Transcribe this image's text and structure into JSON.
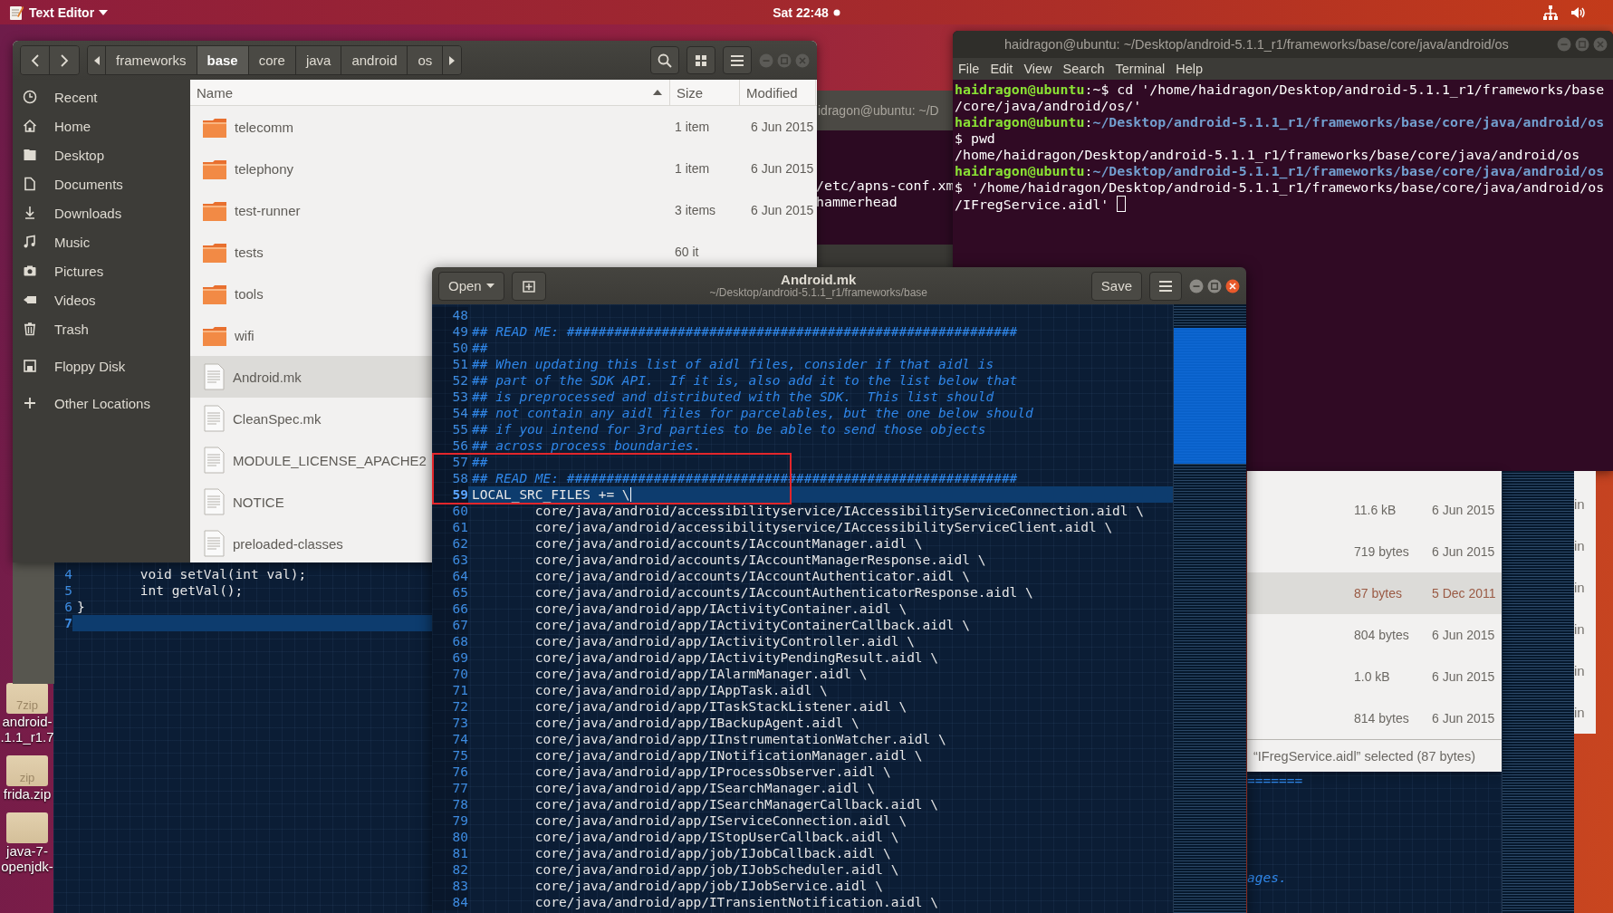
{
  "top_bar": {
    "app_menu": "Text Editor",
    "clock": "Sat 22:48"
  },
  "desktop_icons": [
    {
      "kind": "sevenzip",
      "badge": "7zip",
      "label": [
        "android-",
        ".1.1_r1.7"
      ]
    },
    {
      "kind": "zip",
      "badge": "zip",
      "label": [
        "frida.zip"
      ]
    },
    {
      "kind": "archive",
      "label": [
        "java-7-",
        "openjdk-"
      ]
    }
  ],
  "background_terminal": {
    "title": "idragon@ubuntu: ~/D",
    "lines": [
      "/etc/apns-conf.xm",
      "hammerhead"
    ]
  },
  "file_manager": {
    "path": [
      {
        "label": "frameworks",
        "selected": false
      },
      {
        "label": "base",
        "selected": true
      },
      {
        "label": "core",
        "selected": false
      },
      {
        "label": "java",
        "selected": false
      },
      {
        "label": "android",
        "selected": false
      },
      {
        "label": "os",
        "selected": false
      }
    ],
    "sidebar": [
      {
        "kind": "recent",
        "label": "Recent"
      },
      {
        "kind": "home",
        "label": "Home"
      },
      {
        "kind": "desktop",
        "label": "Desktop"
      },
      {
        "kind": "documents",
        "label": "Documents"
      },
      {
        "kind": "downloads",
        "label": "Downloads"
      },
      {
        "kind": "music",
        "label": "Music"
      },
      {
        "kind": "pictures",
        "label": "Pictures"
      },
      {
        "kind": "videos",
        "label": "Videos"
      },
      {
        "kind": "trash",
        "label": "Trash"
      },
      {
        "kind": "floppy",
        "label": "Floppy Disk"
      },
      {
        "kind": "other",
        "label": "Other Locations"
      }
    ],
    "columns": [
      {
        "label": "Name",
        "sorted": true
      },
      {
        "label": "Size",
        "sorted": false
      },
      {
        "label": "Modified",
        "sorted": false
      }
    ],
    "rows": [
      {
        "kind": "folder",
        "name": "telecomm",
        "size": "1 item",
        "modified": "6 Jun 2015",
        "selected": false
      },
      {
        "kind": "folder",
        "name": "telephony",
        "size": "1 item",
        "modified": "6 Jun 2015",
        "selected": false
      },
      {
        "kind": "folder",
        "name": "test-runner",
        "size": "3 items",
        "modified": "6 Jun 2015",
        "selected": false
      },
      {
        "kind": "folder",
        "name": "tests",
        "size": "60 it",
        "selected": false
      },
      {
        "kind": "folder",
        "name": "tools",
        "selected": false
      },
      {
        "kind": "folder",
        "name": "wifi",
        "selected": false
      },
      {
        "kind": "file",
        "name": "Android.mk",
        "selected": true
      },
      {
        "kind": "file",
        "name": "CleanSpec.mk",
        "selected": false
      },
      {
        "kind": "file",
        "name": "MODULE_LICENSE_APACHE2",
        "selected": false
      },
      {
        "kind": "file",
        "name": "NOTICE",
        "selected": false
      },
      {
        "kind": "file",
        "name": "preloaded-classes",
        "selected": false
      }
    ]
  },
  "background_editor_left": {
    "lines": [
      {
        "number": "4",
        "text": "        void setVal(int val);",
        "current": false
      },
      {
        "number": "5",
        "text": "        int getVal();",
        "current": false
      },
      {
        "number": "6",
        "text": "}",
        "current": false
      },
      {
        "number": "7",
        "current": true
      }
    ]
  },
  "terminal": {
    "title": "haidragon@ubuntu: ~/Desktop/android-5.1.1_r1/frameworks/base/core/java/android/os",
    "menu": [
      "File",
      "Edit",
      "View",
      "Search",
      "Terminal",
      "Help"
    ],
    "lines": [
      [
        {
          "kind": "user",
          "text": "haidragon@ubuntu"
        },
        {
          "kind": "plain",
          "text": ":~$ cd '/home/haidragon/Desktop/android-5.1.1_r1/frameworks/base"
        }
      ],
      [
        {
          "kind": "plain",
          "text": "/core/java/android/os/'"
        }
      ],
      [
        {
          "kind": "user",
          "text": "haidragon@ubuntu"
        },
        {
          "kind": "plain",
          "text": ":"
        },
        {
          "kind": "path",
          "text": "~/Desktop/android-5.1.1_r1/frameworks/base/core/java/android/os"
        }
      ],
      [
        {
          "kind": "plain",
          "text": "$ pwd"
        }
      ],
      [
        {
          "kind": "plain",
          "text": "/home/haidragon/Desktop/android-5.1.1_r1/frameworks/base/core/java/android/os"
        }
      ],
      [
        {
          "kind": "user",
          "text": "haidragon@ubuntu"
        },
        {
          "kind": "plain",
          "text": ":"
        },
        {
          "kind": "path",
          "text": "~/Desktop/android-5.1.1_r1/frameworks/base/core/java/android/os"
        }
      ],
      [
        {
          "kind": "plain",
          "text": "$ '/home/haidragon/Desktop/android-5.1.1_r1/frameworks/base/core/java/android/os"
        }
      ],
      [
        {
          "kind": "plain",
          "text": "/IFregService.aidl' "
        },
        {
          "kind": "cursor"
        }
      ]
    ]
  },
  "background_file_list": {
    "rows": [
      {
        "size": "11.6 kB",
        "modified": "6 Jun 2015",
        "selected": false
      },
      {
        "size": "719 bytes",
        "modified": "6 Jun 2015",
        "selected": false
      },
      {
        "size": "87 bytes",
        "modified": "5 Dec 2011",
        "selected": true
      },
      {
        "size": "804 bytes",
        "modified": "6 Jun 2015",
        "selected": false
      },
      {
        "size": "1.0 kB",
        "modified": "6 Jun 2015",
        "selected": false
      },
      {
        "size": "814 bytes",
        "modified": "6 Jun 2015",
        "selected": false
      }
    ],
    "status": "“IFregService.aidl” selected  (87 bytes)"
  },
  "background_editor_right": {
    "lines": [
      "=======",
      "ages."
    ]
  },
  "background_column": {
    "texts": [
      "in",
      "in",
      "in",
      "in",
      "in",
      "in"
    ]
  },
  "editor": {
    "open_label": "Open",
    "title": "Android.mk",
    "subtitle": "~/Desktop/android-5.1.1_r1/frameworks/base",
    "save_label": "Save",
    "lines": [
      {
        "number": "48",
        "kind": "code",
        "current": false,
        "boxed": false
      },
      {
        "number": "49",
        "kind": "comment",
        "text": "## READ ME: #########################################################",
        "current": false,
        "boxed": false
      },
      {
        "number": "50",
        "kind": "comment",
        "text": "##",
        "current": false,
        "boxed": false
      },
      {
        "number": "51",
        "kind": "comment",
        "text": "## When updating this list of aidl files, consider if that aidl is",
        "current": false,
        "boxed": false
      },
      {
        "number": "52",
        "kind": "comment",
        "text": "## part of the SDK API.  If it is, also add it to the list below that",
        "current": false,
        "boxed": false
      },
      {
        "number": "53",
        "kind": "comment",
        "text": "## is preprocessed and distributed with the SDK.  This list should",
        "current": false,
        "boxed": false
      },
      {
        "number": "54",
        "kind": "comment",
        "text": "## not contain any aidl files for parcelables, but the one below should",
        "current": false,
        "boxed": false
      },
      {
        "number": "55",
        "kind": "comment",
        "text": "## if you intend for 3rd parties to be able to send those objects",
        "current": false,
        "boxed": false
      },
      {
        "number": "56",
        "kind": "comment",
        "text": "## across process boundaries.",
        "current": false,
        "boxed": false
      },
      {
        "number": "57",
        "kind": "comment",
        "text": "##",
        "current": false,
        "boxed": true
      },
      {
        "number": "58",
        "kind": "comment",
        "text": "## READ ME: #########################################################",
        "current": false,
        "boxed": true
      },
      {
        "number": "59",
        "kind": "code",
        "text": "LOCAL_SRC_FILES += \\",
        "current": true,
        "boxed": true
      },
      {
        "number": "60",
        "kind": "code",
        "text": "        core/java/android/accessibilityservice/IAccessibilityServiceConnection.aidl \\",
        "current": false,
        "boxed": false
      },
      {
        "number": "61",
        "kind": "code",
        "text": "        core/java/android/accessibilityservice/IAccessibilityServiceClient.aidl \\",
        "current": false,
        "boxed": false
      },
      {
        "number": "62",
        "kind": "code",
        "text": "        core/java/android/accounts/IAccountManager.aidl \\",
        "current": false,
        "boxed": false
      },
      {
        "number": "63",
        "kind": "code",
        "text": "        core/java/android/accounts/IAccountManagerResponse.aidl \\",
        "current": false,
        "boxed": false
      },
      {
        "number": "64",
        "kind": "code",
        "text": "        core/java/android/accounts/IAccountAuthenticator.aidl \\",
        "current": false,
        "boxed": false
      },
      {
        "number": "65",
        "kind": "code",
        "text": "        core/java/android/accounts/IAccountAuthenticatorResponse.aidl \\",
        "current": false,
        "boxed": false
      },
      {
        "number": "66",
        "kind": "code",
        "text": "        core/java/android/app/IActivityContainer.aidl \\",
        "current": false,
        "boxed": false
      },
      {
        "number": "67",
        "kind": "code",
        "text": "        core/java/android/app/IActivityContainerCallback.aidl \\",
        "current": false,
        "boxed": false
      },
      {
        "number": "68",
        "kind": "code",
        "text": "        core/java/android/app/IActivityController.aidl \\",
        "current": false,
        "boxed": false
      },
      {
        "number": "69",
        "kind": "code",
        "text": "        core/java/android/app/IActivityPendingResult.aidl \\",
        "current": false,
        "boxed": false
      },
      {
        "number": "70",
        "kind": "code",
        "text": "        core/java/android/app/IAlarmManager.aidl \\",
        "current": false,
        "boxed": false
      },
      {
        "number": "71",
        "kind": "code",
        "text": "        core/java/android/app/IAppTask.aidl \\",
        "current": false,
        "boxed": false
      },
      {
        "number": "72",
        "kind": "code",
        "text": "        core/java/android/app/ITaskStackListener.aidl \\",
        "current": false,
        "boxed": false
      },
      {
        "number": "73",
        "kind": "code",
        "text": "        core/java/android/app/IBackupAgent.aidl \\",
        "current": false,
        "boxed": false
      },
      {
        "number": "74",
        "kind": "code",
        "text": "        core/java/android/app/IInstrumentationWatcher.aidl \\",
        "current": false,
        "boxed": false
      },
      {
        "number": "75",
        "kind": "code",
        "text": "        core/java/android/app/INotificationManager.aidl \\",
        "current": false,
        "boxed": false
      },
      {
        "number": "76",
        "kind": "code",
        "text": "        core/java/android/app/IProcessObserver.aidl \\",
        "current": false,
        "boxed": false
      },
      {
        "number": "77",
        "kind": "code",
        "text": "        core/java/android/app/ISearchManager.aidl \\",
        "current": false,
        "boxed": false
      },
      {
        "number": "78",
        "kind": "code",
        "text": "        core/java/android/app/ISearchManagerCallback.aidl \\",
        "current": false,
        "boxed": false
      },
      {
        "number": "79",
        "kind": "code",
        "text": "        core/java/android/app/IServiceConnection.aidl \\",
        "current": false,
        "boxed": false
      },
      {
        "number": "80",
        "kind": "code",
        "text": "        core/java/android/app/IStopUserCallback.aidl \\",
        "current": false,
        "boxed": false
      },
      {
        "number": "81",
        "kind": "code",
        "text": "        core/java/android/app/job/IJobCallback.aidl \\",
        "current": false,
        "boxed": false
      },
      {
        "number": "82",
        "kind": "code",
        "text": "        core/java/android/app/job/IJobScheduler.aidl \\",
        "current": false,
        "boxed": false
      },
      {
        "number": "83",
        "kind": "code",
        "text": "        core/java/android/app/job/IJobService.aidl \\",
        "current": false,
        "boxed": false
      },
      {
        "number": "84",
        "kind": "code",
        "text": "        core/java/android/app/ITransientNotification.aidl \\",
        "current": false,
        "boxed": false
      }
    ]
  }
}
